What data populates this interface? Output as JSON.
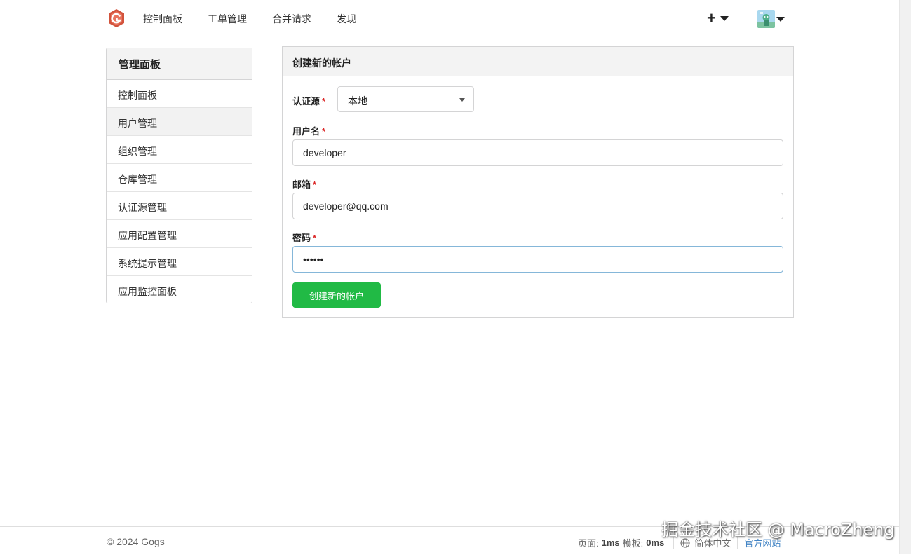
{
  "nav": {
    "items": [
      "控制面板",
      "工单管理",
      "合并请求",
      "发现"
    ],
    "plus_label": "+"
  },
  "sidebar": {
    "title": "管理面板",
    "items": [
      {
        "label": "控制面板"
      },
      {
        "label": "用户管理"
      },
      {
        "label": "组织管理"
      },
      {
        "label": "仓库管理"
      },
      {
        "label": "认证源管理"
      },
      {
        "label": "应用配置管理"
      },
      {
        "label": "系统提示管理"
      },
      {
        "label": "应用监控面板"
      }
    ],
    "active_index": 1
  },
  "form": {
    "title": "创建新的帐户",
    "auth_source": {
      "label": "认证源",
      "value": "本地"
    },
    "username": {
      "label": "用户名",
      "value": "developer"
    },
    "email": {
      "label": "邮箱",
      "value": "developer@qq.com"
    },
    "password": {
      "label": "密码",
      "value": "••••••"
    },
    "required_mark": "*",
    "submit_label": "创建新的帐户"
  },
  "footer": {
    "copyright": "© 2024 Gogs",
    "page_label": "页面:",
    "page_time": "1ms",
    "template_label": "模板:",
    "template_time": "0ms",
    "language": "简体中文",
    "official_site": "官方网站"
  },
  "watermark": "掘金技术社区 @ MacroZheng",
  "colors": {
    "primary_button": "#21ba45",
    "required": "#db2828",
    "link": "#4183c4",
    "focus_border": "#85b7d9"
  }
}
